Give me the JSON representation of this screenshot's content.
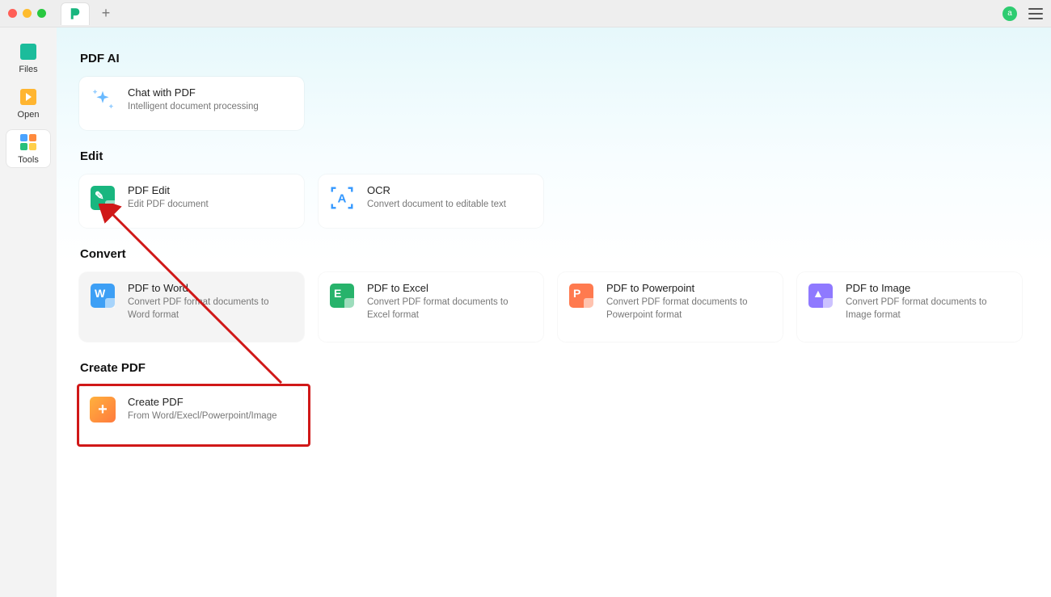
{
  "titlebar": {
    "avatar_initial": "a",
    "plus_label": "+"
  },
  "sidebar": {
    "items": [
      {
        "label": "Files"
      },
      {
        "label": "Open"
      },
      {
        "label": "Tools"
      }
    ]
  },
  "sections": {
    "pdf_ai": {
      "title": "PDF AI",
      "cards": [
        {
          "title": "Chat with PDF",
          "desc": "Intelligent document processing"
        }
      ]
    },
    "edit": {
      "title": "Edit",
      "cards": [
        {
          "title": "PDF Edit",
          "desc": "Edit PDF document"
        },
        {
          "title": "OCR",
          "desc": "Convert document to editable text"
        }
      ]
    },
    "convert": {
      "title": "Convert",
      "cards": [
        {
          "title": "PDF to Word",
          "desc": "Convert PDF format documents to Word format"
        },
        {
          "title": "PDF to Excel",
          "desc": "Convert PDF format documents to Excel format"
        },
        {
          "title": "PDF to Powerpoint",
          "desc": "Convert PDF format documents to Powerpoint format"
        },
        {
          "title": "PDF to Image",
          "desc": "Convert PDF format documents to Image format"
        }
      ]
    },
    "create": {
      "title": "Create PDF",
      "cards": [
        {
          "title": "Create PDF",
          "desc": "From Word/Execl/Powerpoint/Image"
        }
      ]
    }
  }
}
